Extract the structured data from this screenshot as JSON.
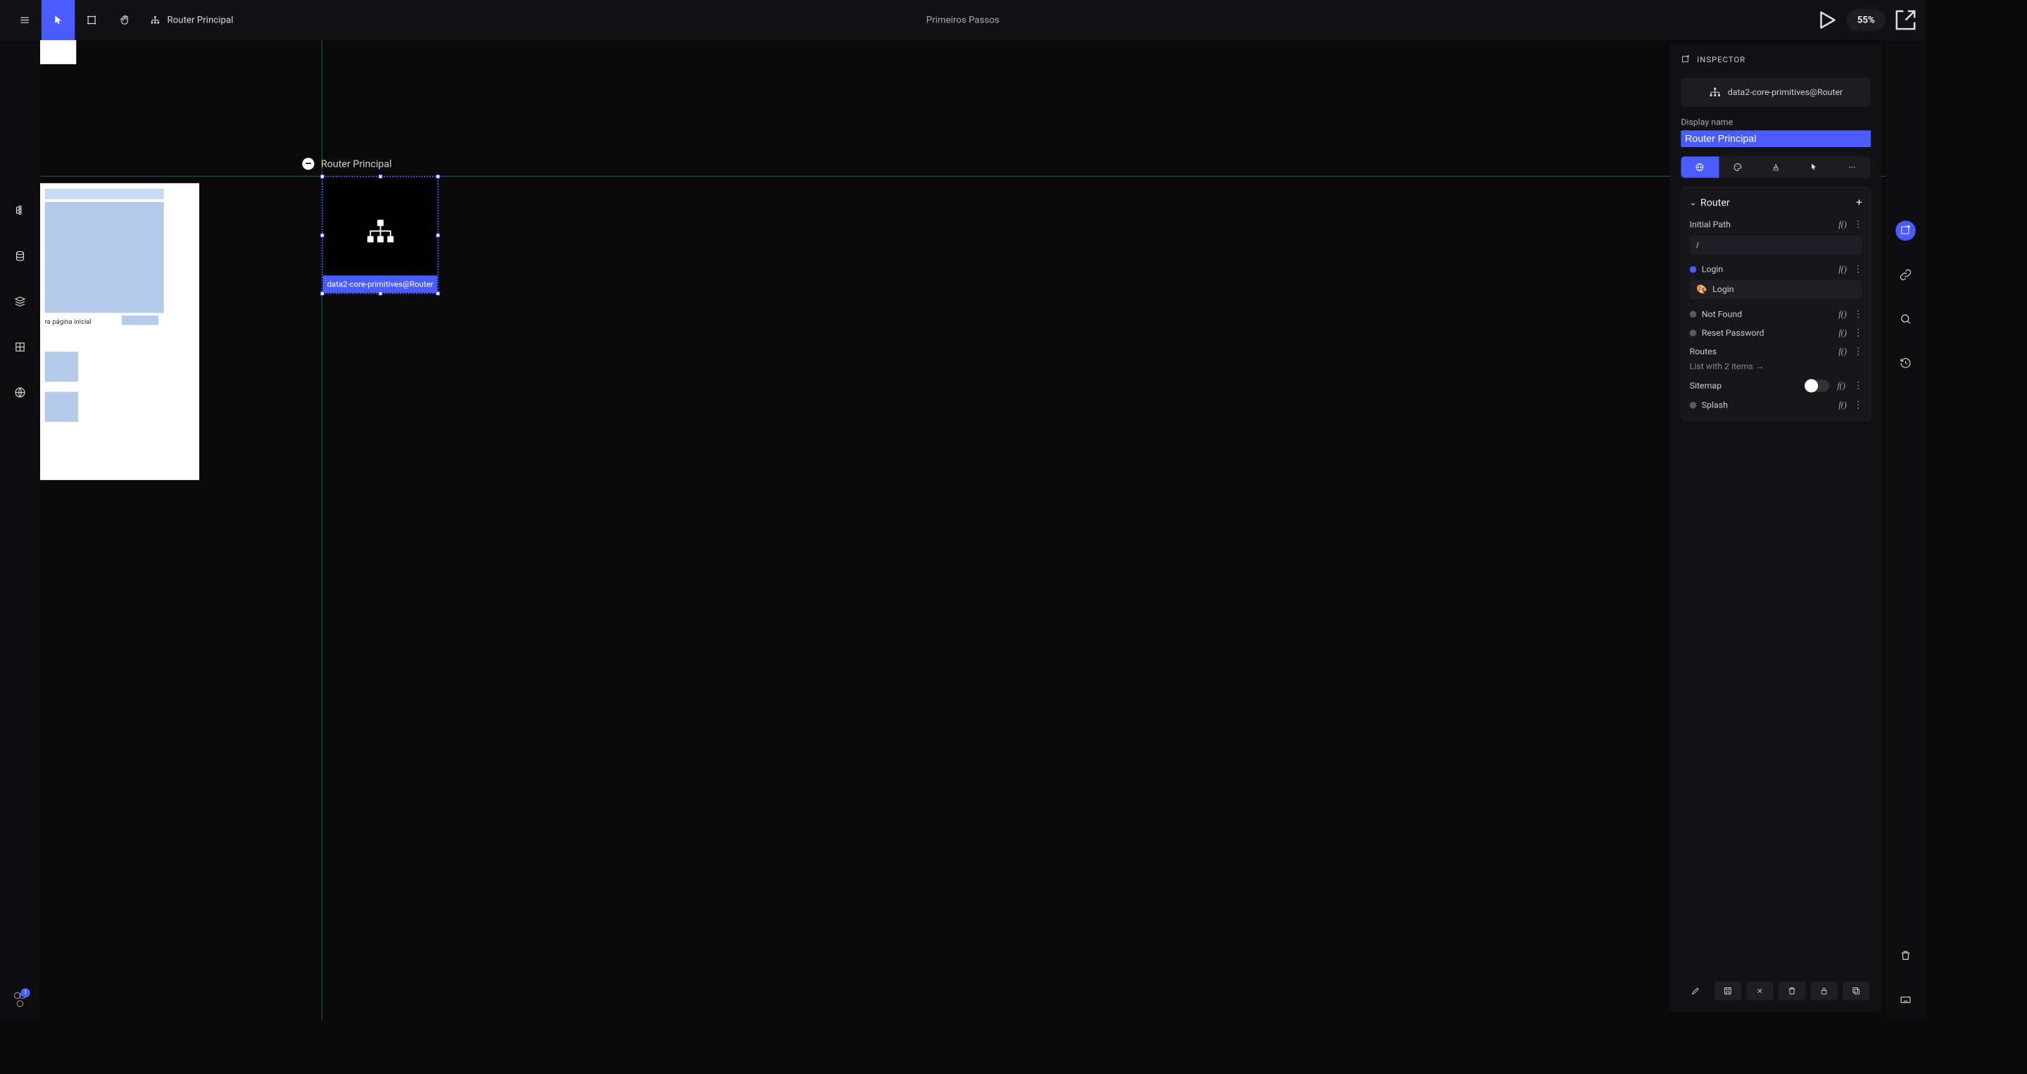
{
  "topbar": {
    "breadcrumb_label": "Router Principal",
    "document_title": "Primeiros Passos",
    "zoom": "55%"
  },
  "canvas": {
    "node_title": "Router Principal",
    "node_chip": "data2-core-primitives@Router",
    "frame_text": "ra página inicial"
  },
  "left_rail": {
    "rings_badge": "1"
  },
  "inspector": {
    "header": "INSPECTOR",
    "type_chip": "data2-core-primitives@Router",
    "display_name_label": "Display name",
    "display_name_value": "Router Principal",
    "section_title": "Router",
    "initial_path_label": "Initial Path",
    "initial_path_value": "/",
    "routes_label": "Routes",
    "routes_desc": "List with 2 items",
    "sitemap_label": "Sitemap",
    "items": {
      "login": "Login",
      "login_page": "Login",
      "not_found": "Not Found",
      "reset_password": "Reset Password",
      "splash": "Splash"
    }
  }
}
